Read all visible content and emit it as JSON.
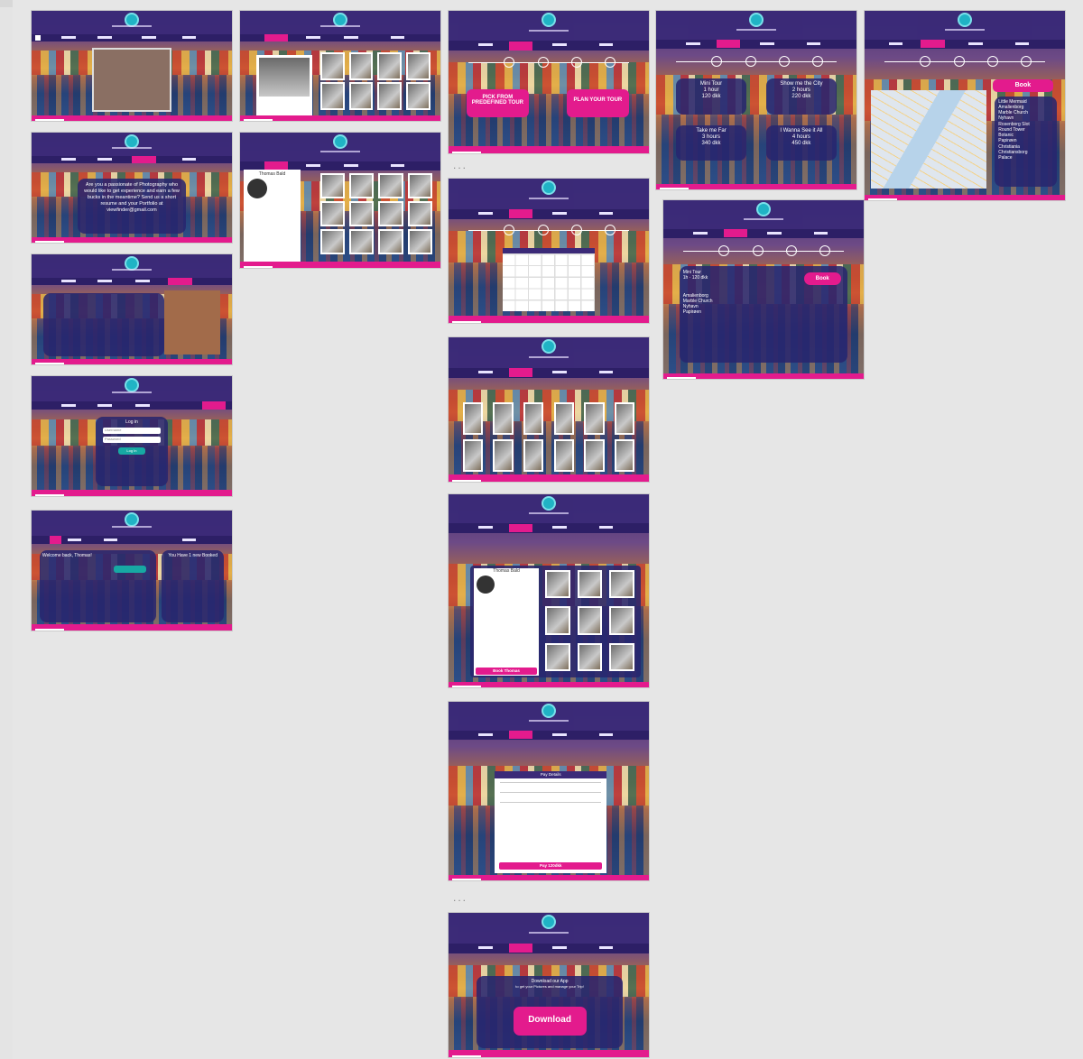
{
  "canvas": {
    "background": "#e4e4e4"
  },
  "colors": {
    "accent": "#e31b8d",
    "header": "#3b2a78",
    "panel": "#282670",
    "logo": "#1fb8c8"
  },
  "boards": {
    "plan_tour": {
      "btn_predefined": "PICK FROM PREDEFINED TOUR",
      "btn_plan": "PLAN YOUR TOUR"
    },
    "tours": {
      "items": [
        {
          "name": "Mini Tour",
          "duration": "1 hour",
          "price": "120 dkk"
        },
        {
          "name": "Show me the City",
          "duration": "2 hours",
          "price": "220 dkk"
        },
        {
          "name": "Take me Far",
          "duration": "3 hours",
          "price": "340 dkk"
        },
        {
          "name": "I Wanna See it All",
          "duration": "4 hours",
          "price": "450 dkk"
        }
      ]
    },
    "map_tour": {
      "book": "Book",
      "stops": [
        "Little Mermaid",
        "Amalienborg",
        "Marble Church",
        "Nyhavn",
        "Rosenborg Slot",
        "Round Tower",
        "Botanic",
        "Papirøen",
        "Christiania",
        "Christiansborg",
        "Palace"
      ]
    },
    "photography": {
      "text": "Are you a passionate of Photography who would like to get experience and earn a few bucks in the meantime? Send us a short resume and your Portfolio at viewfinder@gmail.com"
    },
    "mini_tour_detail": {
      "title": "Mini Tour",
      "meta": "1h · 120 dkk",
      "book": "Book",
      "stops": [
        "Amalienborg",
        "Marble Church",
        "Nyhavn",
        "Papirøen"
      ]
    },
    "photographer": {
      "name": "Thomas Bald",
      "book": "Book Thomas"
    },
    "payment": {
      "title": "Pay Details",
      "pay": "Pay 120dkk"
    },
    "download": {
      "title": "Download our App",
      "subtitle": "to get your Pictures and manage your Trip!",
      "button": "Download"
    },
    "login": {
      "title": "Log in",
      "username": "Username",
      "password": "Password",
      "button": "Log In"
    },
    "account": {
      "welcome": "Welcome back, Thomas!",
      "upcoming": "You Have 1 new Booked"
    }
  }
}
